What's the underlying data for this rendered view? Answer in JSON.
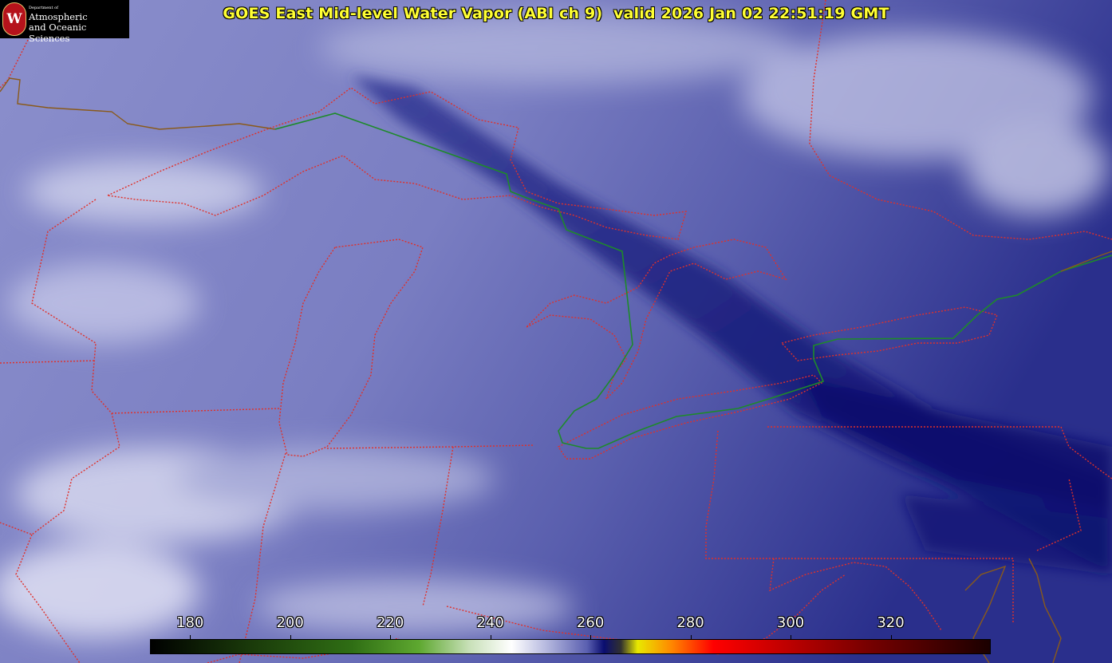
{
  "title": "GOES East Mid-level Water Vapor (ABI ch 9)  valid 2026 Jan 02 22:51:19 GMT",
  "logo": {
    "seal_letter": "W",
    "dept": "Department of",
    "line1": "Atmospheric",
    "line2": "and Oceanic Sciences"
  },
  "colorbar": {
    "ticks": [
      "180",
      "200",
      "220",
      "240",
      "260",
      "280",
      "300",
      "320"
    ],
    "min": 172,
    "max": 340
  },
  "colors": {
    "state_border": "#e0302a",
    "country_border": "#1e8a2a",
    "coast": "#8a5a1a",
    "title": "#ffff33",
    "dry_band": "#1b1f7e",
    "background": "#6f74b6"
  }
}
